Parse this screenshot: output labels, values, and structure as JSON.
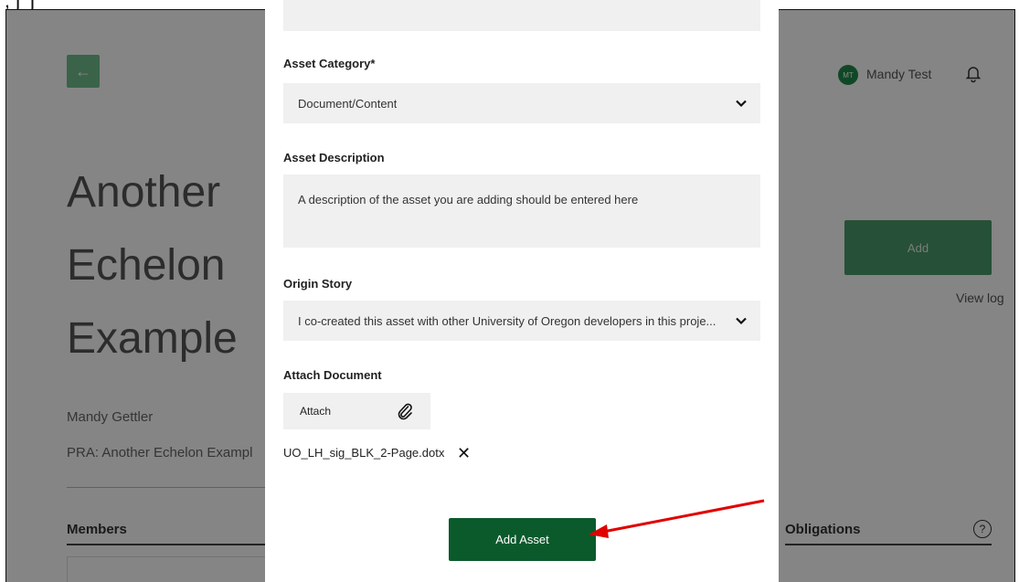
{
  "header": {
    "back_icon": "arrow-left-icon",
    "user_initials": "MT",
    "user_name": "Mandy Test",
    "bell_icon": "bell-icon"
  },
  "project": {
    "title_lines": [
      "Another",
      "Echelon",
      "Example"
    ],
    "owner": "Mandy Gettler",
    "pra": "PRA: Another Echelon Exampl",
    "add_label": "Add",
    "view_log": "View log",
    "members_label": "Members",
    "obligations_label": "Obligations",
    "help_icon": "?"
  },
  "modal": {
    "asset_category_label": "Asset Category*",
    "asset_category_value": "Document/Content",
    "asset_description_label": "Asset Description",
    "asset_description_value": "A description of the asset you are adding should be entered here",
    "origin_story_label": "Origin Story",
    "origin_story_value": "I co-created this asset with other University of Oregon developers in this proje...",
    "attach_document_label": "Attach Document",
    "attach_button_label": "Attach",
    "attached_file": "UO_LH_sig_BLK_2-Page.dotx",
    "remove_icon": "✕",
    "submit_label": "Add Asset"
  },
  "colors": {
    "accent_green": "#0b5a2c",
    "light_green": "#6fbf8c",
    "annotation_red": "#e00000"
  }
}
